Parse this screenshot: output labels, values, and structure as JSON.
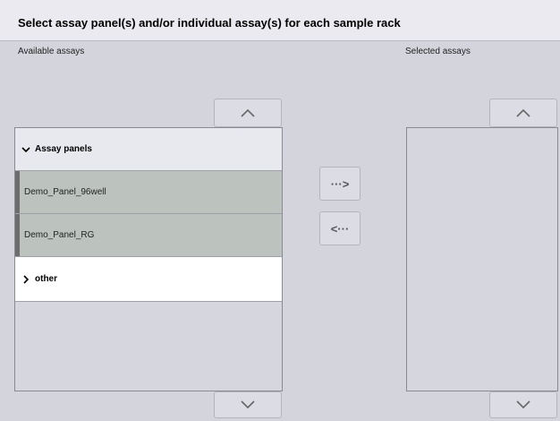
{
  "header": {
    "title": "Select assay panel(s) and/or individual assay(s) for each sample rack"
  },
  "available": {
    "label": "Available assays",
    "groups": [
      {
        "label": "Assay panels",
        "icon": "chevron-down-icon",
        "expanded": true
      },
      {
        "label": "other",
        "icon": "chevron-right-icon",
        "expanded": false
      }
    ],
    "items": [
      "Demo_Panel_96well",
      "Demo_Panel_RG"
    ]
  },
  "selected": {
    "label": "Selected assays"
  },
  "transfer": {
    "add_label": "···>",
    "remove_label": "<···"
  },
  "colors": {
    "background": "#d4d4dc",
    "item_bg": "#bcc3bf",
    "marker": "#6d6d6d"
  }
}
